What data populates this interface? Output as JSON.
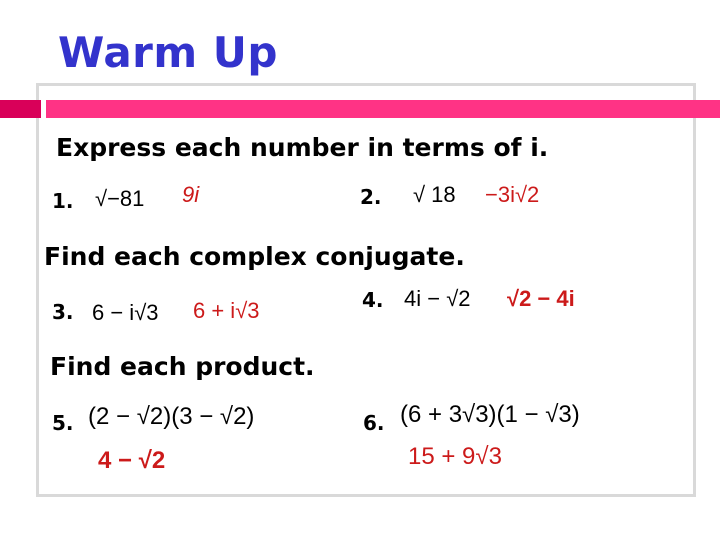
{
  "title": "Warm Up",
  "sections": [
    {
      "heading": "Express each number in terms of i.",
      "problems": [
        {
          "number": "1.",
          "expression": "√−81",
          "answer": "9i"
        },
        {
          "number": "2.",
          "expression": "√ 18",
          "answer": "−3i√2"
        }
      ]
    },
    {
      "heading": "Find each complex conjugate.",
      "problems": [
        {
          "number": "3.",
          "expression": "6 − i√3",
          "answer": "6 + i√3"
        },
        {
          "number": "4.",
          "expression": "4i − √2",
          "answer": "√2 − 4i"
        }
      ]
    },
    {
      "heading": "Find each product.",
      "problems": [
        {
          "number": "5.",
          "expression": "(2 − √2)(3 − √2)",
          "answer": "4 − √2"
        },
        {
          "number": "6.",
          "expression": "(6 + 3√3)(1 − √3)",
          "answer": "15 + 9√3"
        }
      ]
    }
  ],
  "colors": {
    "title": "#3333cc",
    "accent_bar": "#ff3385",
    "accent_bar_dark": "#d90059",
    "answer": "#cc1a1a",
    "frame": "#d9d9d9"
  }
}
